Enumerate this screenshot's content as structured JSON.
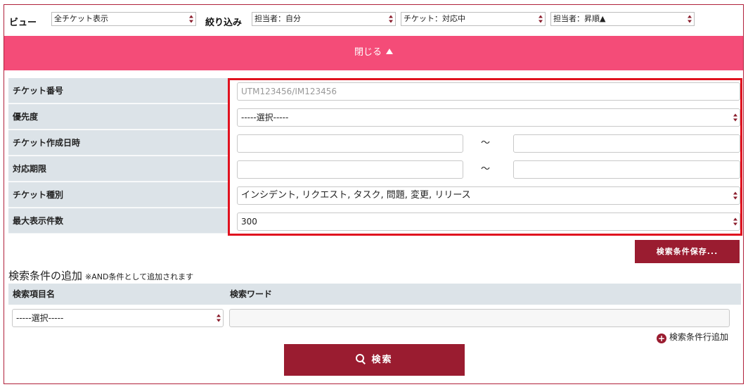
{
  "topbar": {
    "view_label": "ビュー",
    "view_value": "全チケット表示",
    "filter_label": "絞り込み",
    "filter_assignee": "担当者：自分",
    "filter_ticket": "チケット：対応中",
    "sort_value": "担当者：昇順▲"
  },
  "closebar": {
    "label": "閉じる"
  },
  "criteria": {
    "ticket_no_label": "チケット番号",
    "ticket_no_placeholder": "UTM123456/IM123456",
    "priority_label": "優先度",
    "priority_value": "-----選択-----",
    "created_label": "チケット作成日時",
    "deadline_label": "対応期限",
    "range_sep": "～",
    "type_label": "チケット種別",
    "type_value": "インシデント, リクエスト, タスク, 問題, 変更, リリース",
    "max_label": "最大表示件数",
    "max_value": "300"
  },
  "save_button": "検索条件保存...",
  "add_section": {
    "title": "検索条件の追加",
    "note": "※AND条件として追加されます",
    "col_item": "検索項目名",
    "col_word": "検索ワード",
    "item_value": "-----選択-----",
    "add_row_label": "検索条件行追加"
  },
  "search_button": "検索",
  "colors": {
    "accent": "#9a1c30",
    "pink": "#f44c78",
    "highlight": "#e0121f",
    "label_bg": "#dce3e8"
  }
}
